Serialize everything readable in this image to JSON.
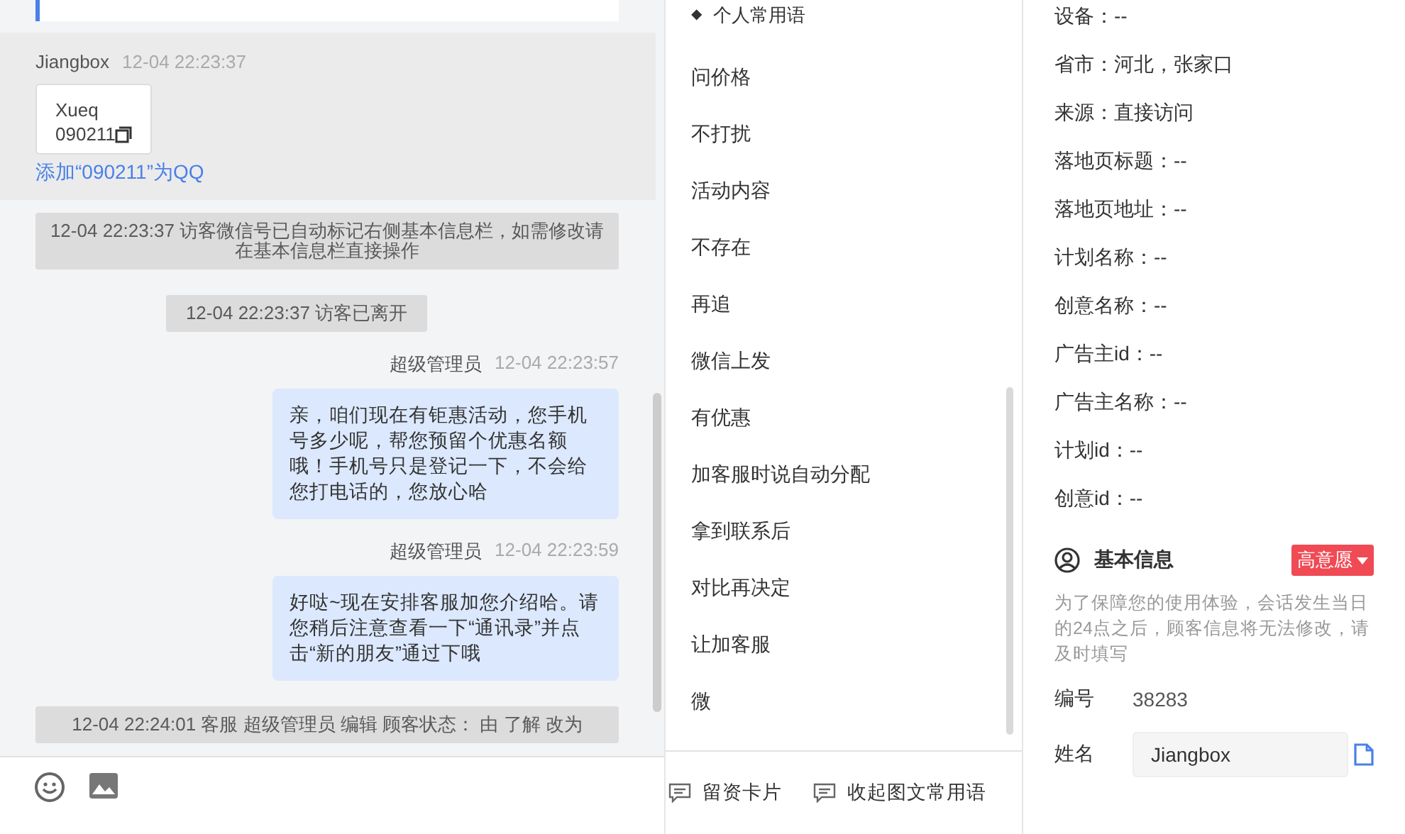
{
  "chat": {
    "visitor_message": {
      "sender": "Jiangbox",
      "time": "12-04 22:23:37",
      "card_lines": [
        "Xueq",
        "090211"
      ],
      "link": "添加“090211”为QQ"
    },
    "notices": [
      {
        "text": "12-04 22:23:37 访客微信号已自动标记右侧基本信息栏，如需修改请在基本信息栏直接操作",
        "wide": true
      },
      {
        "text": "12-04 22:23:37 访客已离开",
        "wide": false
      }
    ],
    "agent_messages": [
      {
        "sender": "超级管理员",
        "time": "12-04 22:23:57",
        "text": "亲，咱们现在有钜惠活动，您手机号多少呢，帮您预留个优惠名额哦！手机号只是登记一下，不会给您打电话的，您放心哈"
      },
      {
        "sender": "超级管理员",
        "time": "12-04 22:23:59",
        "text": "好哒~现在安排客服加您介绍哈。请您稍后注意查看一下“通讯录”并点击“新的朋友”通过下哦"
      }
    ],
    "last_notice": "12-04 22:24:01 客服 超级管理员 编辑 顾客状态： 由 了解 改为"
  },
  "phrases": {
    "header_icon": "◆",
    "header": "个人常用语",
    "items": [
      "问价格",
      "不打扰",
      "活动内容",
      "不存在",
      "再追",
      "微信上发",
      "有优惠",
      "加客服时说自动分配",
      "拿到联系后",
      "对比再决定",
      "让加客服",
      "微"
    ],
    "buttons": [
      "留资卡片",
      "收起图文常用语"
    ]
  },
  "info": {
    "fields": [
      "设备：--",
      "省市：河北，张家口",
      "来源：直接访问",
      "落地页标题：--",
      "落地页地址：--",
      "计划名称：--",
      "创意名称：--",
      "广告主id：--",
      "广告主名称：--",
      "计划id：--",
      "创意id：--"
    ],
    "section_title": "基本信息",
    "intent_tag": "高意愿",
    "notice": "为了保障您的使用体验，会话发生当日的24点之后，顾客信息将无法修改，请及时填写",
    "number_label": "编号",
    "number": "38283",
    "name_label": "姓名",
    "name_value": "Jiangbox"
  }
}
